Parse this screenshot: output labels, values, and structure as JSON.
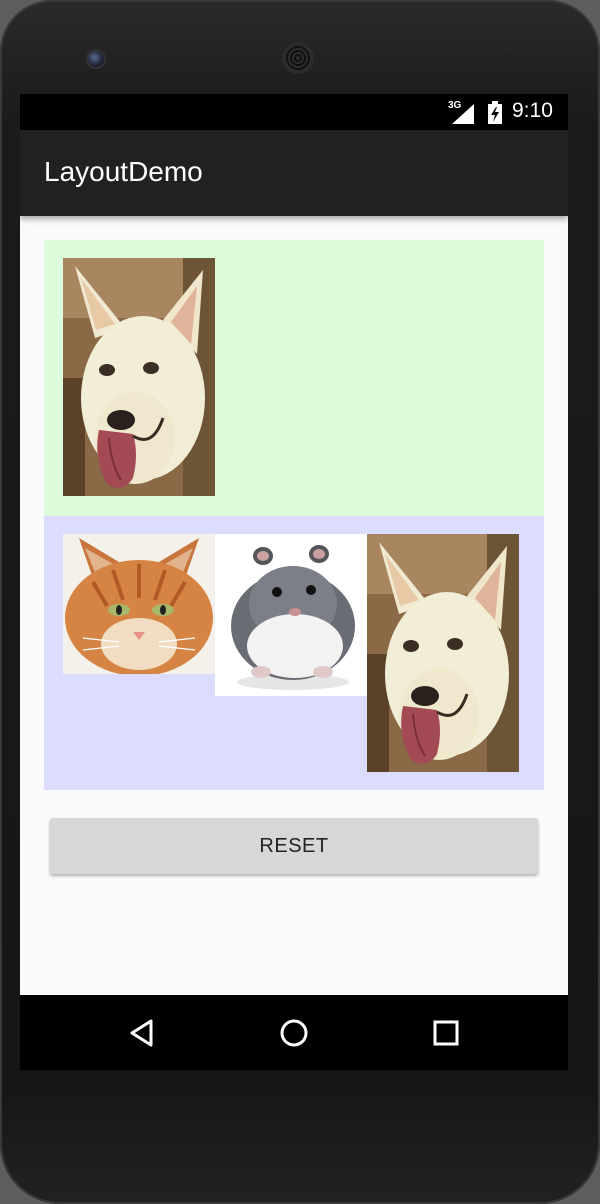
{
  "status_bar": {
    "network": "3G",
    "time": "9:10",
    "icons": [
      "signal-icon",
      "battery-icon"
    ]
  },
  "app_bar": {
    "title": "LayoutDemo"
  },
  "panels": {
    "top": {
      "color": "#ddfcdc",
      "images": [
        "dog-image"
      ]
    },
    "bottom": {
      "color": "#dcdcfe",
      "images": [
        "cat-image",
        "hamster-image",
        "dog-image"
      ]
    }
  },
  "buttons": {
    "reset": "RESET"
  },
  "nav_bar": {
    "icons": [
      "back-icon",
      "home-icon",
      "recents-icon"
    ]
  }
}
